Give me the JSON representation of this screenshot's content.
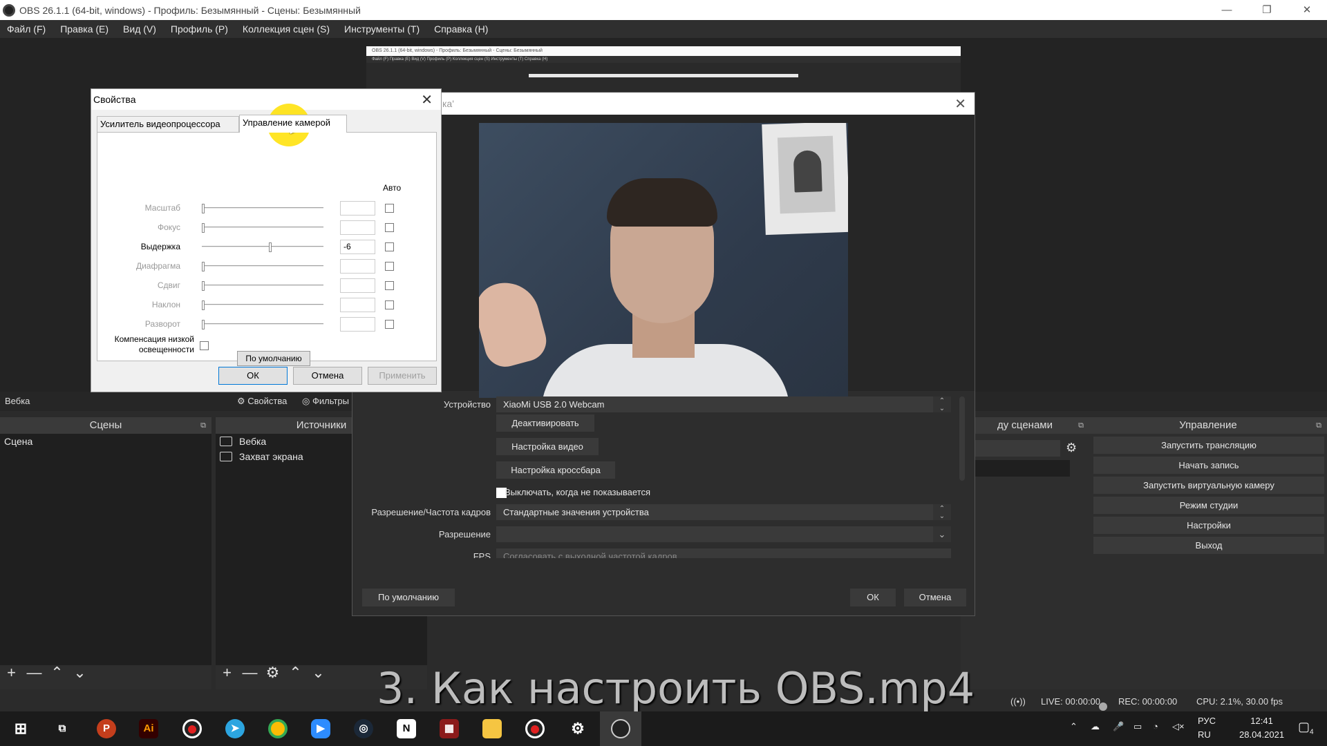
{
  "window": {
    "title": "OBS 26.1.1 (64-bit, windows) - Профиль: Безымянный - Сцены: Безымянный",
    "minimize": "—",
    "maximize": "❐",
    "close": "✕"
  },
  "menu": [
    "Файл (F)",
    "Правка (E)",
    "Вид (V)",
    "Профиль (P)",
    "Коллекция сцен (S)",
    "Инструменты (T)",
    "Справка (H)"
  ],
  "mini_preview": {
    "title": "OBS 26.1.1 (64-bit, windows) - Профиль: Безымянный - Сцены: Безымянный",
    "menu": "Файл (F)   Правка (E)   Вид (V)   Профиль (P)   Коллекция сцен (S)   Инструменты (T)   Справка (H)"
  },
  "source_bar": {
    "selected_source": "Вебка",
    "properties_label": "Свойства",
    "filters_label": "Фильтры"
  },
  "scenes": {
    "header": "Сцены",
    "items": [
      "Сцена"
    ],
    "tools": [
      "+",
      "—",
      "⌃",
      "⌄"
    ]
  },
  "sources": {
    "header": "Источники",
    "items": [
      {
        "icon": "camera-icon",
        "label": "Вебка"
      },
      {
        "icon": "monitor-icon",
        "label": "Захват экрана"
      }
    ],
    "tools": [
      "+",
      "—",
      "⚙",
      "⌃",
      "⌄"
    ]
  },
  "transitions": {
    "header_partial": "ду сценами"
  },
  "controls": {
    "header": "Управление",
    "buttons": [
      "Запустить трансляцию",
      "Начать запись",
      "Запустить виртуальную камеру",
      "Режим студии",
      "Настройки",
      "Выход"
    ]
  },
  "status": {
    "live": "LIVE: 00:00:00",
    "rec": "REC: 00:00:00",
    "cpu": "CPU: 2.1%, 30.00 fps"
  },
  "watermark": "3. Как настроить OBS.mp4",
  "webcam_dialog": {
    "title_partial": "ка'",
    "device_label": "Устройство",
    "device_value": "XiaoMi USB 2.0 Webcam",
    "deactivate_button": "Деактивировать",
    "video_config_button": "Настройка видео",
    "crossbar_config_button": "Настройка кроссбара",
    "hide_checkbox_label": "Выключать, когда не показывается",
    "resolution_fps_label": "Разрешение/Частота кадров",
    "resolution_fps_value": "Стандартные значения устройства",
    "resolution_label": "Разрешение",
    "resolution_value": "",
    "fps_label": "FPS",
    "fps_value": "Согласовать с выходной частотой кадров",
    "defaults_button": "По умолчанию",
    "ok_button": "ОК",
    "cancel_button": "Отмена"
  },
  "camera_dialog": {
    "title": "Свойства",
    "tab_video_proc": "Усилитель видеопроцессора",
    "tab_camera_control": "Управление камерой",
    "auto_label": "Авто",
    "controls": [
      {
        "label": "Масштаб",
        "value": "",
        "slider": 0.0,
        "enabled": false
      },
      {
        "label": "Фокус",
        "value": "",
        "slider": 0.0,
        "enabled": false
      },
      {
        "label": "Выдержка",
        "value": "-6",
        "slider": 0.55,
        "enabled": true
      },
      {
        "label": "Диафрагма",
        "value": "",
        "slider": 0.0,
        "enabled": false
      },
      {
        "label": "Сдвиг",
        "value": "",
        "slider": 0.0,
        "enabled": false
      },
      {
        "label": "Наклон",
        "value": "",
        "slider": 0.0,
        "enabled": false
      },
      {
        "label": "Разворот",
        "value": "",
        "slider": 0.0,
        "enabled": false
      }
    ],
    "low_light_label_1": "Компенсация низкой",
    "low_light_label_2": "освещенности",
    "defaults_button": "По умолчанию",
    "ok_button": "ОК",
    "cancel_button": "Отмена",
    "apply_button": "Применить"
  },
  "taskbar": {
    "lang_1": "РУС",
    "lang_2": "RU",
    "time": "12:41",
    "date": "28.04.2021",
    "notif_count": "4"
  }
}
